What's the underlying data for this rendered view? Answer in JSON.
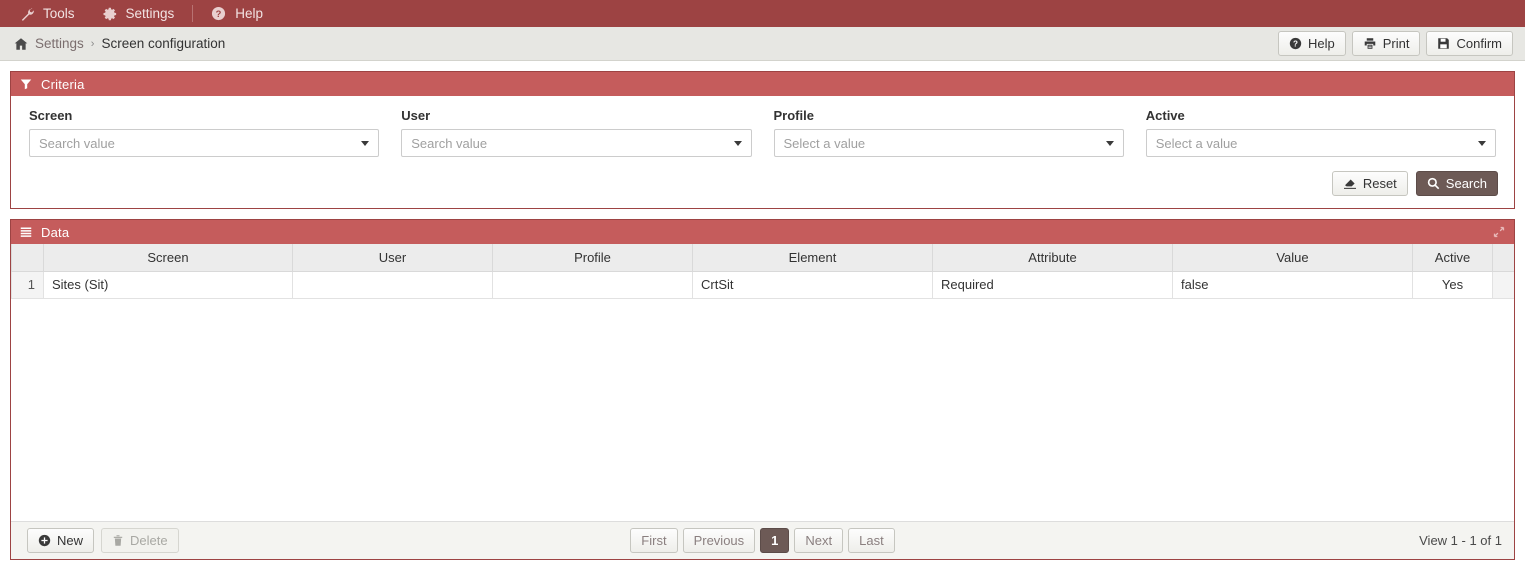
{
  "topbar": {
    "items": [
      {
        "label": "Tools",
        "icon": "wrench-icon"
      },
      {
        "label": "Settings",
        "icon": "gear-icon"
      },
      {
        "label": "Help",
        "icon": "question-circle-icon"
      }
    ]
  },
  "breadcrumb": {
    "home_icon": "home-icon",
    "parent": "Settings",
    "separator": "›",
    "current": "Screen configuration",
    "actions": [
      {
        "label": "Help",
        "icon": "question-circle-icon"
      },
      {
        "label": "Print",
        "icon": "printer-icon"
      },
      {
        "label": "Confirm",
        "icon": "save-icon"
      }
    ]
  },
  "criteria": {
    "panel_title": "Criteria",
    "panel_icon": "filter-icon",
    "fields": [
      {
        "label": "Screen",
        "placeholder": "Search value",
        "value": "",
        "icon": "chevron-down-icon"
      },
      {
        "label": "User",
        "placeholder": "Search value",
        "value": "",
        "icon": "chevron-down-icon"
      },
      {
        "label": "Profile",
        "placeholder": "Select a value",
        "value": "",
        "icon": "chevron-down-icon"
      },
      {
        "label": "Active",
        "placeholder": "Select a value",
        "value": "",
        "icon": "chevron-down-icon"
      }
    ],
    "reset_label": "Reset",
    "reset_icon": "eraser-icon",
    "search_label": "Search",
    "search_icon": "magnifier-icon"
  },
  "data": {
    "panel_title": "Data",
    "panel_icon": "list-icon",
    "expand_icon": "expand-arrows-icon",
    "columns": [
      "",
      "Screen",
      "User",
      "Profile",
      "Element",
      "Attribute",
      "Value",
      "Active",
      "",
      ""
    ],
    "rows": [
      {
        "num": "1",
        "screen": "Sites (Sit)",
        "user": "",
        "profile": "",
        "element": "CrtSit",
        "attribute": "Required",
        "value": "false",
        "active": "Yes"
      }
    ],
    "footer": {
      "new_label": "New",
      "new_icon": "plus-circle-icon",
      "delete_label": "Delete",
      "delete_icon": "trash-icon",
      "pager": {
        "first": "First",
        "previous": "Previous",
        "current": "1",
        "next": "Next",
        "last": "Last"
      },
      "view_text": "View 1 - 1 of 1"
    }
  },
  "colors": {
    "topbar": "#9d4343",
    "panel_header": "#c55c5c",
    "panel_border": "#9d4343",
    "breadcrumb_bg": "#e7e7e3",
    "active_page": "#6d5a56"
  }
}
